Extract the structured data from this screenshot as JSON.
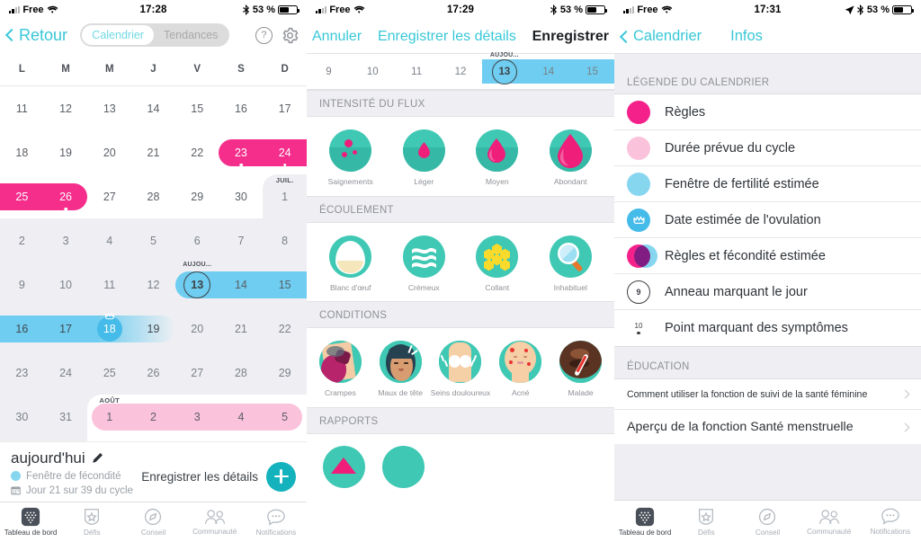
{
  "panel1": {
    "status": {
      "carrier": "Free",
      "time": "17:28",
      "battery": "53 %"
    },
    "nav": {
      "back": "Retour",
      "seg_calendar": "Calendrier",
      "seg_trends": "Tendances",
      "help": "?"
    },
    "weekdays": [
      "L",
      "M",
      "M",
      "J",
      "V",
      "S",
      "D"
    ],
    "weeks": [
      {
        "days": [
          "11",
          "12",
          "13",
          "14",
          "15",
          "16",
          "17"
        ]
      },
      {
        "days": [
          "18",
          "19",
          "20",
          "21",
          "22",
          "23",
          "24"
        ]
      },
      {
        "days": [
          "25",
          "26",
          "27",
          "28",
          "29",
          "30",
          "1"
        ],
        "month_tag": "JUIL."
      },
      {
        "days": [
          "2",
          "3",
          "4",
          "5",
          "6",
          "7",
          "8"
        ]
      },
      {
        "days": [
          "9",
          "10",
          "11",
          "12",
          "13",
          "14",
          "15"
        ],
        "today_label": "AUJOU..."
      },
      {
        "days": [
          "16",
          "17",
          "18",
          "19",
          "20",
          "21",
          "22"
        ]
      },
      {
        "days": [
          "23",
          "24",
          "25",
          "26",
          "27",
          "28",
          "29"
        ]
      },
      {
        "days": [
          "30",
          "31",
          "1",
          "2",
          "3",
          "4",
          "5"
        ],
        "month_tag": "AOÛT"
      }
    ],
    "today": {
      "title": "aujourd'hui",
      "fertility_label": "Fenêtre de fécondité",
      "cycle_label": "Jour 21 sur 39 du cycle",
      "save_label": "Enregistrer les détails"
    }
  },
  "panel2": {
    "status": {
      "carrier": "Free",
      "time": "17:29",
      "battery": "53 %"
    },
    "nav": {
      "cancel": "Annuler",
      "title": "Enregistrer les détails",
      "save": "Enregistrer"
    },
    "datestrip": {
      "days": [
        "9",
        "10",
        "11",
        "12",
        "13",
        "14",
        "15"
      ],
      "today_label": "AUJOU...",
      "today": "13"
    },
    "sections": [
      {
        "title": "INTENSITÉ DU FLUX",
        "items": [
          {
            "label": "Saignements",
            "icon": "spotting-icon"
          },
          {
            "label": "Léger",
            "icon": "light-drop-icon"
          },
          {
            "label": "Moyen",
            "icon": "medium-drop-icon"
          },
          {
            "label": "Abondant",
            "icon": "heavy-drop-icon"
          }
        ]
      },
      {
        "title": "ÉCOULEMENT",
        "items": [
          {
            "label": "Blanc d'œuf",
            "icon": "egg-white-icon"
          },
          {
            "label": "Crémeux",
            "icon": "creamy-icon"
          },
          {
            "label": "Collant",
            "icon": "sticky-honeycomb-icon"
          },
          {
            "label": "Inhabituel",
            "icon": "unusual-magnifier-icon"
          }
        ]
      },
      {
        "title": "CONDITIONS",
        "items": [
          {
            "label": "Crampes",
            "icon": "cramps-icon"
          },
          {
            "label": "Maux de tête",
            "icon": "headache-icon"
          },
          {
            "label": "Seins douloureux",
            "icon": "breast-tenderness-icon"
          },
          {
            "label": "Acné",
            "icon": "acne-icon"
          },
          {
            "label": "Malade",
            "icon": "sick-thermometer-icon"
          }
        ]
      },
      {
        "title": "RAPPORTS",
        "items": []
      }
    ]
  },
  "panel3": {
    "status": {
      "carrier": "Free",
      "time": "17:31",
      "battery": "53 %"
    },
    "nav": {
      "back": "Calendrier",
      "title": "Infos"
    },
    "legend_title": "LÉGENDE DU CALENDRIER",
    "legend": [
      {
        "label": "Règles",
        "icon": "solid-pink-circle-icon",
        "color": "#f5218b"
      },
      {
        "label": "Durée prévue du cycle",
        "icon": "light-pink-circle-icon",
        "color": "#fbc2dc"
      },
      {
        "label": "Fenêtre de fertilité estimée",
        "icon": "light-blue-circle-icon",
        "color": "#86d6ef"
      },
      {
        "label": "Date estimée de l'ovulation",
        "icon": "ovulation-crown-circle-icon",
        "color": "#44bbe8"
      },
      {
        "label": "Règles et fécondité estimée",
        "icon": "overlap-circles-icon",
        "color": "#f5218b"
      },
      {
        "label": "Anneau marquant le jour",
        "icon": "day-ring-icon",
        "sample": "9"
      },
      {
        "label": "Point marquant des symptômes",
        "icon": "symptom-dot-icon",
        "sample": "10"
      }
    ],
    "education_title": "ÉDUCATION",
    "education": [
      {
        "label": "Comment utiliser la fonction de suivi de la santé féminine"
      },
      {
        "label": "Aperçu de la fonction Santé menstruelle"
      }
    ]
  },
  "tabbar": {
    "items": [
      {
        "label": "Tableau de bord",
        "icon": "dashboard-icon",
        "active": true
      },
      {
        "label": "Défis",
        "icon": "star-shield-icon",
        "active": false
      },
      {
        "label": "Conseil",
        "icon": "compass-icon",
        "active": false
      },
      {
        "label": "Communauté",
        "icon": "people-icon",
        "active": false
      },
      {
        "label": "Notifications",
        "icon": "chat-dots-icon",
        "active": false
      }
    ]
  },
  "colors": {
    "accent_teal": "#14b2bd",
    "nav_cyan": "#38c8d8",
    "period_pink": "#f5218b",
    "predicted_pink": "#fbc2dc",
    "fertility_blue": "#6ecdf0",
    "ovulation_blue": "#44bbe8",
    "icon_teal": "#3fc8b4",
    "grey_bg": "#efeff3"
  }
}
